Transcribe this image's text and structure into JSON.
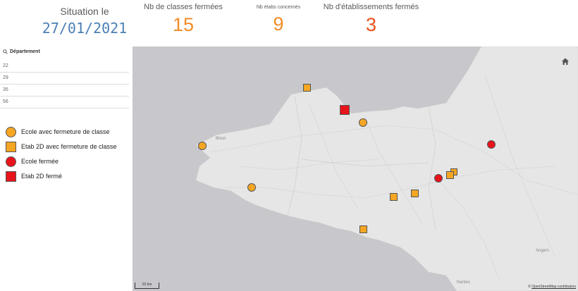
{
  "kpis": {
    "date_label": "Situation le",
    "date_value": "27/01/2021",
    "classes_label": "Nb de classes fermées",
    "classes_value": "15",
    "etabs_label": "Nb étabs concernés",
    "etabs_value": "9",
    "closed_label": "Nb d'établissements fermés",
    "closed_value": "3"
  },
  "filter": {
    "title": "Département",
    "items": [
      "22",
      "29",
      "35",
      "56"
    ]
  },
  "legend": {
    "items": [
      {
        "label": "Ecole avec fermeture de classe",
        "shape": "circle",
        "color": "#F5A623"
      },
      {
        "label": "Etab 2D avec fermeture de classe",
        "shape": "square",
        "color": "#F5A623"
      },
      {
        "label": "Ecole fermée",
        "shape": "circle",
        "color": "#E8141B"
      },
      {
        "label": "Etab 2D fermé",
        "shape": "square",
        "color": "#E8141B"
      }
    ]
  },
  "colors": {
    "date": "#4a7fb5",
    "orange": "#F28C28",
    "red_kpi": "#E8501B",
    "amber": "#F5A623",
    "red": "#E8141B"
  },
  "map": {
    "labels": {
      "brest": "Brest",
      "angers": "Angers",
      "nantes": "Nantes"
    },
    "scale": "20 km",
    "attribution_prefix": "© ",
    "attribution_link": "OpenStreetMap contributors",
    "home_icon": "home-icon"
  }
}
